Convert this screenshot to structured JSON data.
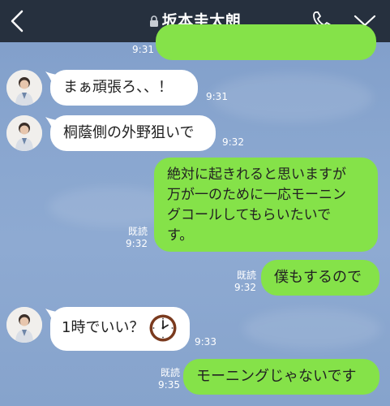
{
  "header": {
    "title": "坂本圭太朗",
    "page_dots": 3,
    "active_dot": 0
  },
  "messages": [
    {
      "id": "m0",
      "side": "out",
      "text": "",
      "time": "9:31"
    },
    {
      "id": "m1",
      "side": "in",
      "text": "まぁ頑張ろ、、！",
      "time": "9:31"
    },
    {
      "id": "m2",
      "side": "in",
      "text": "桐蔭側の外野狙いで",
      "time": "9:32"
    },
    {
      "id": "m3",
      "side": "out",
      "lines": [
        "絶対に起きれると思いますが",
        "万が一のために一応モーニン",
        "グコールしてもらいたいで",
        "す。"
      ],
      "read": "既読",
      "time": "9:32"
    },
    {
      "id": "m4",
      "side": "out",
      "text": "僕もするので",
      "read": "既読",
      "time": "9:32"
    },
    {
      "id": "m5",
      "side": "in",
      "text": "1時でいい？",
      "time": "9:33",
      "icon": "clock-icon"
    },
    {
      "id": "m6",
      "side": "out",
      "text": "モーニングじゃないです",
      "read": "既読",
      "time": "9:35"
    }
  ],
  "colors": {
    "header_bg": "#26303e",
    "bubble_out": "#85e249",
    "bubble_in": "#ffffff",
    "background": "#89a6cf"
  }
}
